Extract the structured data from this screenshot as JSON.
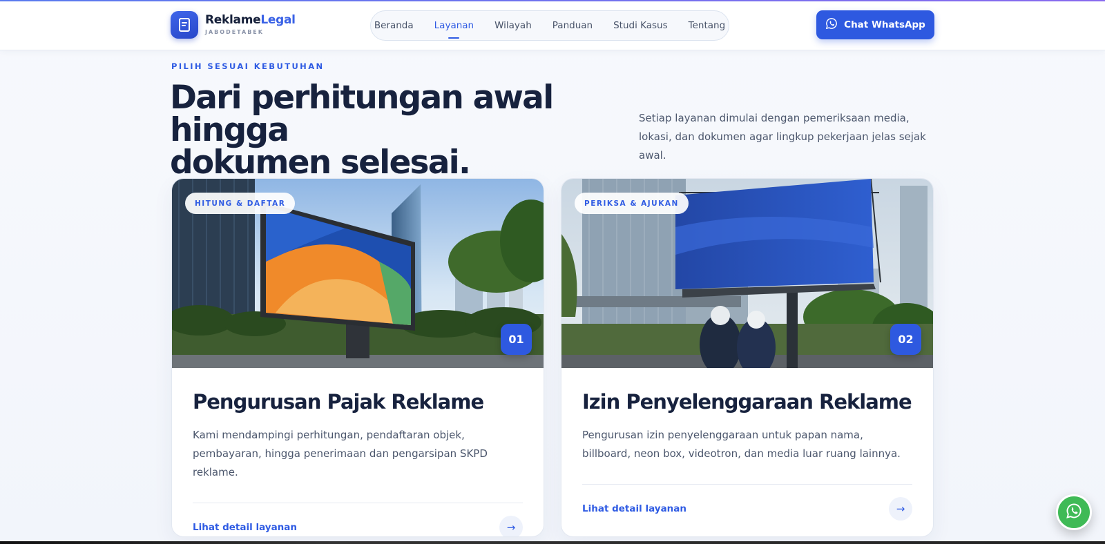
{
  "brand": {
    "name_part1": "Reklame",
    "name_part2": "Legal",
    "subtitle": "JABODETABEK"
  },
  "nav": {
    "items": [
      {
        "label": "Beranda",
        "active": false
      },
      {
        "label": "Layanan",
        "active": true
      },
      {
        "label": "Wilayah",
        "active": false
      },
      {
        "label": "Panduan",
        "active": false
      },
      {
        "label": "Studi Kasus",
        "active": false
      },
      {
        "label": "Tentang",
        "active": false
      }
    ]
  },
  "header": {
    "cta_label": "Chat WhatsApp"
  },
  "hero": {
    "eyebrow": "PILIH SESUAI KEBUTUHAN",
    "headline_line1": "Dari perhitungan awal hingga",
    "headline_line2": "dokumen selesai.",
    "intro": "Setiap layanan dimulai dengan pemeriksaan media, lokasi, dan dokumen agar lingkup pekerjaan jelas sejak awal."
  },
  "services": [
    {
      "tag": "HITUNG & DAFTAR",
      "number": "01",
      "title": "Pengurusan Pajak Reklame",
      "description": "Kami mendampingi perhitungan, pendaftaran objek, pembayaran, hingga penerimaan dan pengarsipan SKPD reklame.",
      "link_label": "Lihat detail layanan",
      "arrow": "→"
    },
    {
      "tag": "PERIKSA & AJUKAN",
      "number": "02",
      "title": "Izin Penyelenggaraan Reklame",
      "description": "Pengurusan izin penyelenggaraan untuk papan nama, billboard, neon box, videotron, dan media luar ruang lainnya.",
      "link_label": "Lihat detail layanan",
      "arrow": "→"
    }
  ],
  "colors": {
    "primary": "#2e59e0",
    "heading": "#17223e",
    "whatsapp": "#3fba56"
  },
  "icons": {
    "logo": "document-icon",
    "cta": "whatsapp-icon",
    "float": "whatsapp-icon"
  }
}
